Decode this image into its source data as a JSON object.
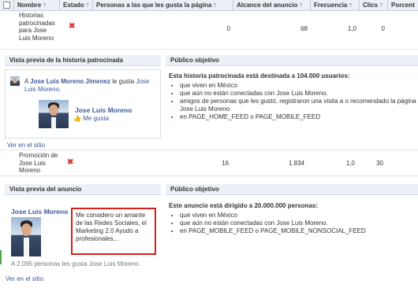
{
  "table": {
    "headers": [
      {
        "label": "Nombre",
        "help": "?"
      },
      {
        "label": "Estado",
        "help": "?"
      },
      {
        "label": "Personas a las que les gusta la página",
        "help": "?"
      },
      {
        "label": "Alcance del anuncio",
        "help": "?"
      },
      {
        "label": "Frecuencia",
        "help": "?"
      },
      {
        "label": "Clics",
        "help": "?"
      },
      {
        "label": "Porcent",
        "help": ""
      }
    ],
    "row1": {
      "name": "Historias patrocinadas para Jose Luis Moreno",
      "likes": "0",
      "reach": "68",
      "freq": "1,0",
      "clicks": "0"
    },
    "row2": {
      "name": "Promoción de Jose Luis Moreno",
      "likes": "16",
      "reach": "1.834",
      "freq": "1,0",
      "clicks": "30"
    }
  },
  "section1": {
    "preview_title": "Vista previa de la historia patrocinada",
    "story_prefix": "A",
    "story_name": "Jose Luis Moreno Jimenez",
    "story_suffix": "le gusta",
    "story_page": "Jose Luis Moreno.",
    "page_name": "Jose Luis Moreno",
    "like_label": "Me gusta",
    "view_link": "Ver en el sitio",
    "audience_title": "Público objetivo",
    "audience_summary": "Esta historia patrocinada está destinada a 104.000 usuarios:",
    "audience_items": [
      "que viven en México",
      "que aún no están conectadas con Jose Luis Moreno.",
      "amigos de personas que les gustó, registraron una visita a o recomendado la página Jose Luis Moreno",
      "en PAGE_HOME_FEED o PAGE_MOBILE_FEED"
    ]
  },
  "section2": {
    "preview_title": "Vista previa del anuncio",
    "ad_title": "Jose Luis Moreno",
    "ad_body": "Me considero un amante de las Redes Sociales, el Marketing 2.0 Ayudo a profesionales...",
    "ad_social": "A 2.095 personas les gusta Jose Luis Moreno.",
    "view_link": "Ver en el sitio",
    "audience_title": "Público objetivo",
    "audience_summary": "Este anuncio está dirigido a 20.000.000 personas:",
    "audience_items": [
      "que viven en México",
      "que aún no están conectadas con Jose Luis Moreno.",
      "en PAGE_MOBILE_FEED o PAGE_MOBILE_NONSOCIAL_FEED"
    ]
  },
  "colors": {
    "link": "#3b5998",
    "header_bg": "#eceff5",
    "highlight": "#d21f1f"
  }
}
